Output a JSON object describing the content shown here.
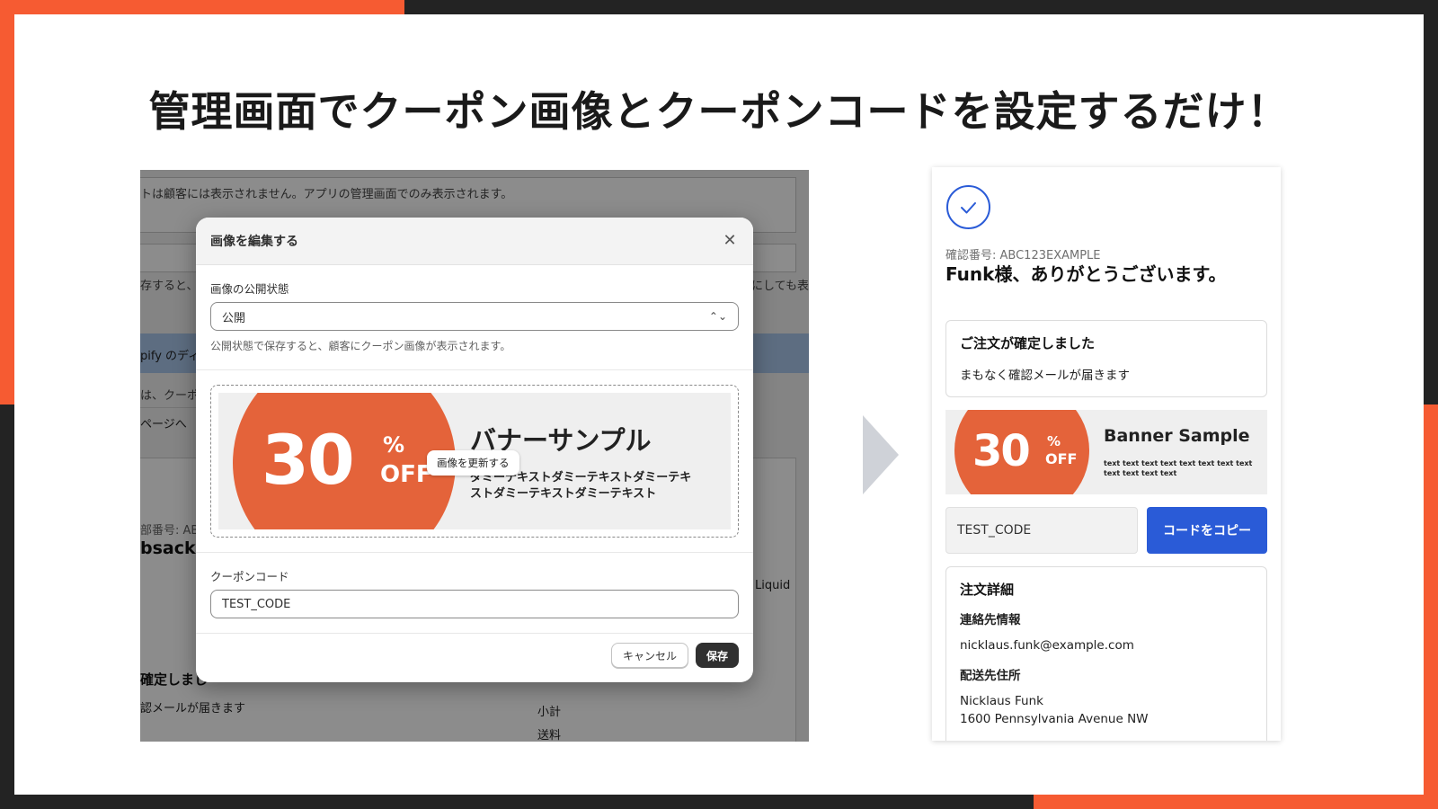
{
  "headline": "管理画面でクーポン画像とクーポンコードを設定するだけ！",
  "colors": {
    "accent": "#f65b32",
    "dark": "#232323",
    "banner_orange": "#e4633a",
    "primary_blue": "#2a5bd7"
  },
  "background_page": {
    "note": "トは顧客には表示されません。アプリの管理画面でのみ表示されます。",
    "partial_1": "存すると、顧",
    "partial_1_right": "にしても表示",
    "banner_partial": "pify のディ",
    "partial_2": "は、クーポ",
    "link_partial": "ページへ",
    "order_no_partial": "部番号: ABC",
    "name_partial": "bsack様",
    "liquid": "Liquid",
    "confirmed_partial": "確定しまし",
    "mail_partial": "認メールが届きます",
    "subtotal": "小計",
    "shipping": "送料"
  },
  "modal": {
    "title": "画像を編集する",
    "visibility_label": "画像の公開状態",
    "visibility_value": "公開",
    "visibility_help": "公開状態で保存すると、顧客にクーポン画像が表示されます。",
    "update_image_label": "画像を更新する",
    "coupon_code_label": "クーポンコード",
    "coupon_code_value": "TEST_CODE",
    "cancel_label": "キャンセル",
    "save_label": "保存"
  },
  "banner_jp": {
    "number": "30",
    "percent": "%",
    "off": "OFF",
    "title": "バナーサンプル",
    "sub_line1": "ダミーテキストダミーテキストダミーテキ",
    "sub_line2": "ストダミーテキストダミーテキスト"
  },
  "phone": {
    "confirmation_number": "確認番号: ABC123EXAMPLE",
    "thanks": "Funk様、ありがとうございます。",
    "order_confirmed_title": "ご注文が確定しました",
    "order_confirmed_text": "まもなく確認メールが届きます",
    "banner": {
      "number": "30",
      "percent": "%",
      "off": "OFF",
      "title": "Banner Sample",
      "sub_line1": "text text text text text text text text",
      "sub_line2": "text text text text"
    },
    "coupon_code": "TEST_CODE",
    "copy_button": "コードをコピー",
    "details_title": "注文詳細",
    "contact_label": "連絡先情報",
    "email": "nicklaus.funk@example.com",
    "shipping_label": "配送先住所",
    "ship_name": "Nicklaus Funk",
    "ship_address": "1600 Pennsylvania Avenue NW"
  }
}
